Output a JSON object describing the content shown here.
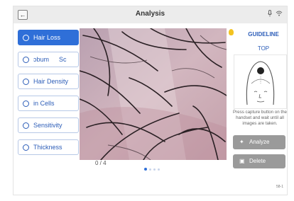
{
  "header": {
    "title": "Analysis",
    "back_icon": "arrow-left-icon",
    "back_glyph": "←",
    "icons": [
      "microphone-icon",
      "wifi-icon"
    ]
  },
  "menu": {
    "items": [
      {
        "label": "Hair Loss",
        "active": true,
        "icon": "hair-loss-icon"
      },
      {
        "label": "ɔbum",
        "extra": "Sc",
        "active": false,
        "icon": "sebum-icon"
      },
      {
        "label": "Hair Density",
        "active": false,
        "icon": "hair-density-icon"
      },
      {
        "label": "in Cells",
        "active": false,
        "icon": "dead-cells-icon"
      },
      {
        "label": "Sensitivity",
        "active": false,
        "icon": "sensitivity-icon"
      },
      {
        "label": "Thickness",
        "active": false,
        "icon": "thickness-icon"
      }
    ]
  },
  "capture": {
    "counter": "0 / 4",
    "page_dots": 4,
    "current_dot": 1
  },
  "guideline": {
    "title": "GUIDELINE",
    "position": "TOP",
    "instruction": "Press capture button on the handset and wait until all images are taken.",
    "buttons": [
      {
        "label": "Analyze",
        "icon": "analyze-icon",
        "glyph": "✦"
      },
      {
        "label": "Delete",
        "icon": "trash-icon",
        "glyph": "▣"
      }
    ]
  },
  "footer": {
    "version": "58-1"
  },
  "colors": {
    "accent": "#2f6fd8",
    "button_gray": "#9a9a9a",
    "bulb": "#f3c321"
  }
}
